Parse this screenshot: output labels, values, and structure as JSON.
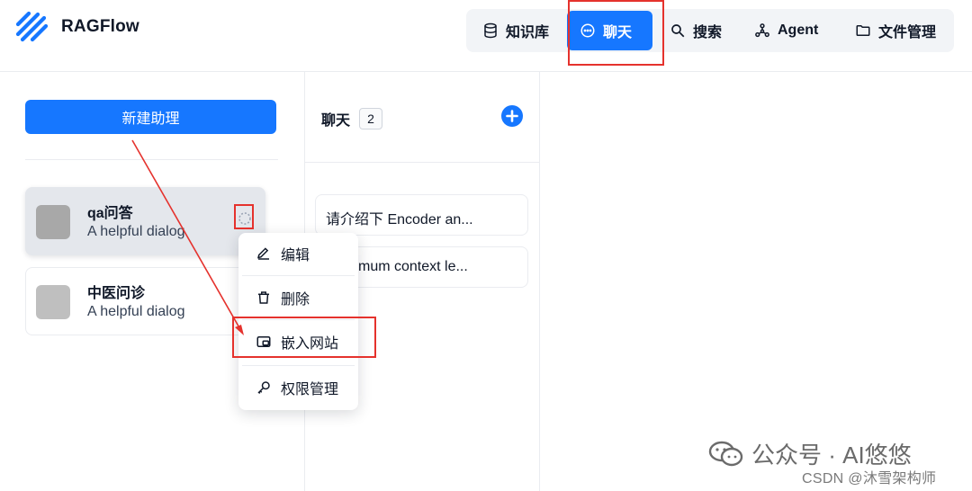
{
  "header": {
    "brand": "RAGFlow",
    "nav": [
      {
        "label": "知识库",
        "icon": "database-icon",
        "active": false
      },
      {
        "label": "聊天",
        "icon": "chat-bubble-icon",
        "active": true
      },
      {
        "label": "搜索",
        "icon": "search-icon",
        "active": false
      },
      {
        "label": "Agent",
        "icon": "graph-icon",
        "active": false
      },
      {
        "label": "文件管理",
        "icon": "folder-icon",
        "active": false
      }
    ]
  },
  "sidebar": {
    "new_button": "新建助理",
    "assistants": [
      {
        "name": "qa问答",
        "description": "A helpful dialog"
      },
      {
        "name": "中医问诊",
        "description": "A helpful dialog"
      }
    ]
  },
  "chats": {
    "title": "聊天",
    "count": "2",
    "conversations": [
      {
        "title": "请介绍下 Encoder an..."
      },
      {
        "title": "mum context le..."
      }
    ]
  },
  "context_menu": {
    "items": [
      {
        "label": "编辑",
        "icon": "edit-icon"
      },
      {
        "label": "删除",
        "icon": "trash-icon"
      },
      {
        "label": "嵌入网站",
        "icon": "embed-icon"
      },
      {
        "label": "权限管理",
        "icon": "key-icon"
      }
    ]
  },
  "watermark": {
    "wechat": "公众号 · AI悠悠",
    "csdn": "CSDN @沐雪架构师"
  },
  "colors": {
    "primary": "#1677ff",
    "annotation": "#e5322d"
  }
}
